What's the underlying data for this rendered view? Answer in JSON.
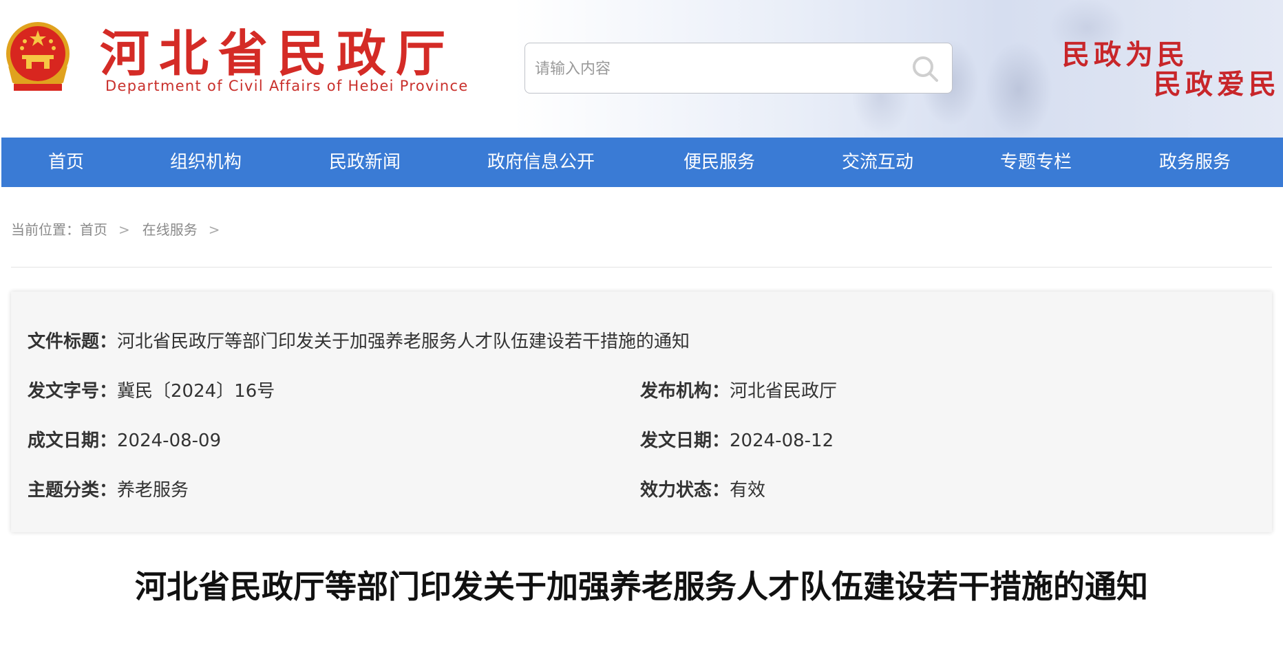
{
  "header": {
    "site_title": "河北省民政厅",
    "site_subtitle": "Department of Civil Affairs of Hebei Province",
    "emblem_icon": "national-emblem-icon",
    "search": {
      "placeholder": "请输入内容",
      "value": "",
      "button_icon": "search-icon"
    },
    "slogan_line1": "民政为民",
    "slogan_line2": "民政爱民",
    "colors": {
      "title_red": "#d42b26",
      "slogan_red": "#c8262a"
    }
  },
  "nav": {
    "background": "#3a7bd5",
    "items": [
      {
        "label": "首页"
      },
      {
        "label": "组织机构"
      },
      {
        "label": "民政新闻"
      },
      {
        "label": "政府信息公开"
      },
      {
        "label": "便民服务"
      },
      {
        "label": "交流互动"
      },
      {
        "label": "专题专栏"
      },
      {
        "label": "政务服务"
      }
    ]
  },
  "breadcrumb": {
    "prefix": "当前位置：",
    "items": [
      {
        "label": "首页"
      },
      {
        "label": "在线服务"
      }
    ],
    "separator": ">"
  },
  "document_info": {
    "title_label": "文件标题：",
    "title_value": "河北省民政厅等部门印发关于加强养老服务人才队伍建设若干措施的通知",
    "number_label": "发文字号：",
    "number_value": "冀民〔2024〕16号",
    "issuer_label": "发布机构：",
    "issuer_value": "河北省民政厅",
    "written_date_label": "成文日期：",
    "written_date_value": "2024-08-09",
    "issue_date_label": "发文日期：",
    "issue_date_value": "2024-08-12",
    "topic_label": "主题分类：",
    "topic_value": "养老服务",
    "status_label": "效力状态：",
    "status_value": "有效"
  },
  "article": {
    "title": "河北省民政厅等部门印发关于加强养老服务人才队伍建设若干措施的通知"
  }
}
